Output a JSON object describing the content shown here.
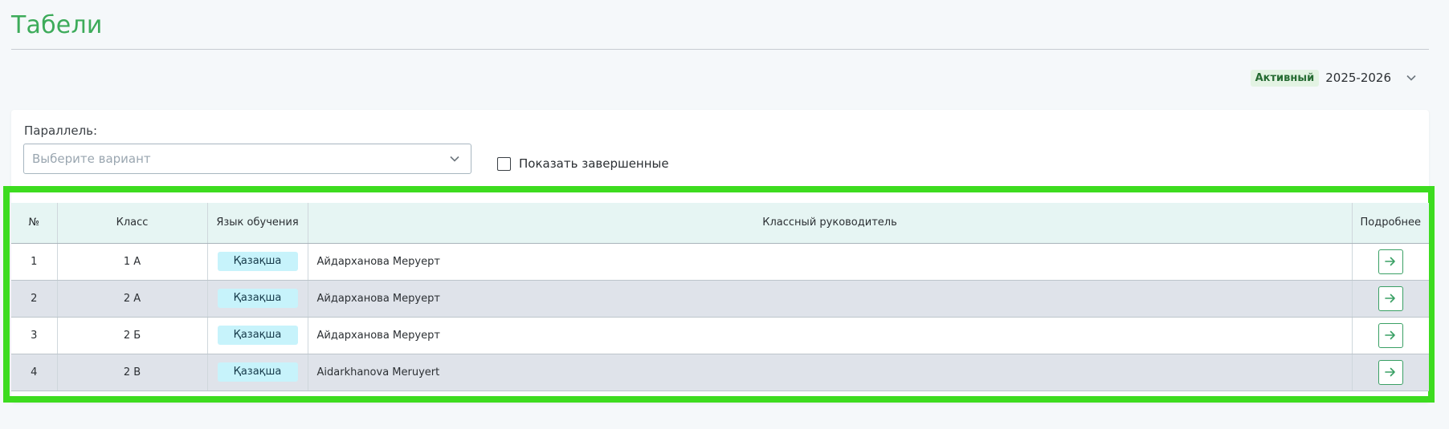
{
  "page": {
    "title": "Табели"
  },
  "year_selector": {
    "status": "Активный",
    "year": "2025-2026",
    "icon": "chevron-down-icon"
  },
  "filters": {
    "parallel_label": "Параллель:",
    "parallel_placeholder": "Выберите вариант",
    "show_completed_label": "Показать завершенные",
    "show_completed_checked": false
  },
  "table": {
    "headers": [
      "№",
      "Класс",
      "Язык обучения",
      "Классный руководитель",
      "Подробнее"
    ],
    "rows": [
      {
        "num": "1",
        "class": "1 А",
        "language": "Қазақша",
        "teacher": "Айдарханова Меруерт"
      },
      {
        "num": "2",
        "class": "2 А",
        "language": "Қазақша",
        "teacher": "Айдарханова Меруерт"
      },
      {
        "num": "3",
        "class": "2 Б",
        "language": "Қазақша",
        "teacher": "Айдарханова Меруерт"
      },
      {
        "num": "4",
        "class": "2 В",
        "language": "Қазақша",
        "teacher": "Aidarkhanova Meruyert"
      }
    ]
  },
  "colors": {
    "accent_green": "#3dab5a",
    "highlight_frame": "#3ddc1f",
    "header_bg": "#e6f5f3",
    "lang_tag_bg": "#c7f3fb",
    "alt_row_bg": "#dfe3ea"
  }
}
